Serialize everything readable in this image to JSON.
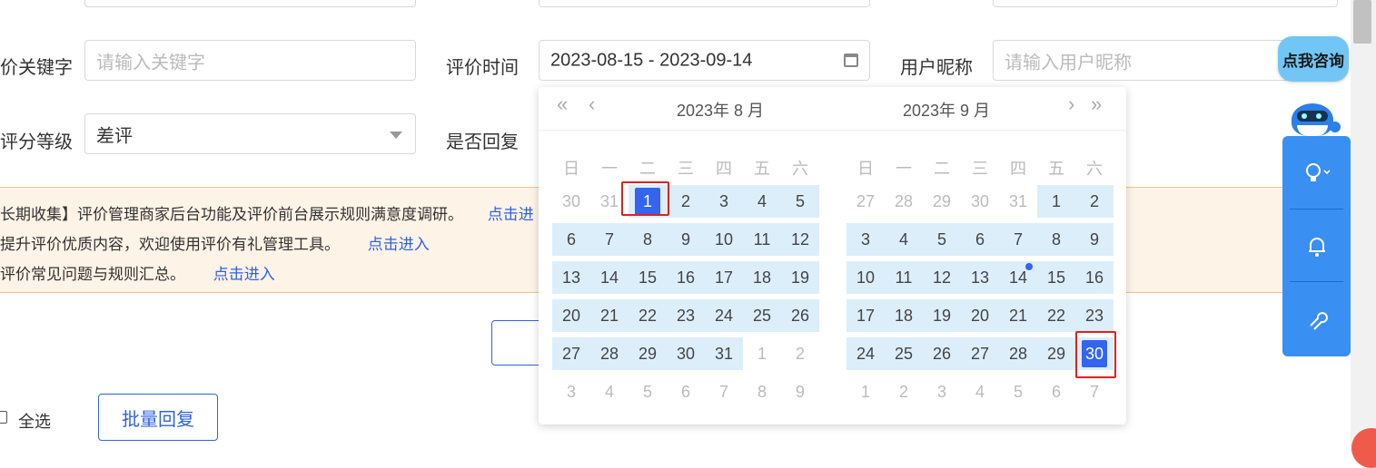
{
  "filters": {
    "keyword_label": "价关键字",
    "keyword_placeholder": "请输入关键字",
    "eval_time_label": "评价时间",
    "eval_time_value": "2023-08-15 - 2023-09-14",
    "nickname_label": "用户昵称",
    "nickname_placeholder": "请输入用户昵称",
    "rating_label": "评分等级",
    "rating_value": "差评",
    "reply_label": "是否回复"
  },
  "notices": [
    {
      "text": "长期收集】评价管理商家后台功能及评价前台展示规则满意度调研。",
      "link": "点击进"
    },
    {
      "text": "提升评价优质内容，欢迎使用评价有礼管理工具。",
      "link": "点击进入"
    },
    {
      "text": "评价常见问题与规则汇总。",
      "link": "点击进入"
    }
  ],
  "bottom": {
    "select_all": "全选",
    "batch_reply": "批量回复"
  },
  "datepicker": {
    "left_title": "2023年 8 月",
    "right_title": "2023年 9 月",
    "prev_year": "«",
    "prev_month": "‹",
    "next_month": "›",
    "next_year": "»",
    "weekdays": [
      "日",
      "一",
      "二",
      "三",
      "四",
      "五",
      "六"
    ],
    "left_days": [
      [
        "30",
        "31",
        "1",
        "2",
        "3",
        "4",
        "5"
      ],
      [
        "6",
        "7",
        "8",
        "9",
        "10",
        "11",
        "12"
      ],
      [
        "13",
        "14",
        "15",
        "16",
        "17",
        "18",
        "19"
      ],
      [
        "20",
        "21",
        "22",
        "23",
        "24",
        "25",
        "26"
      ],
      [
        "27",
        "28",
        "29",
        "30",
        "31",
        "1",
        "2"
      ],
      [
        "3",
        "4",
        "5",
        "6",
        "7",
        "8",
        "9"
      ]
    ],
    "right_days": [
      [
        "27",
        "28",
        "29",
        "30",
        "31",
        "1",
        "2"
      ],
      [
        "3",
        "4",
        "5",
        "6",
        "7",
        "8",
        "9"
      ],
      [
        "10",
        "11",
        "12",
        "13",
        "14",
        "15",
        "16"
      ],
      [
        "17",
        "18",
        "19",
        "20",
        "21",
        "22",
        "23"
      ],
      [
        "24",
        "25",
        "26",
        "27",
        "28",
        "29",
        "30"
      ],
      [
        "1",
        "2",
        "3",
        "4",
        "5",
        "6",
        "7"
      ]
    ]
  },
  "assistant": {
    "bubble_text": "点我咨询"
  },
  "colors": {
    "accent": "#3564f0",
    "range": "#ddeefb",
    "sidebar": "#3a8ff2",
    "notice_bg": "#fdf3e7",
    "highlight_box": "#e0211f"
  }
}
